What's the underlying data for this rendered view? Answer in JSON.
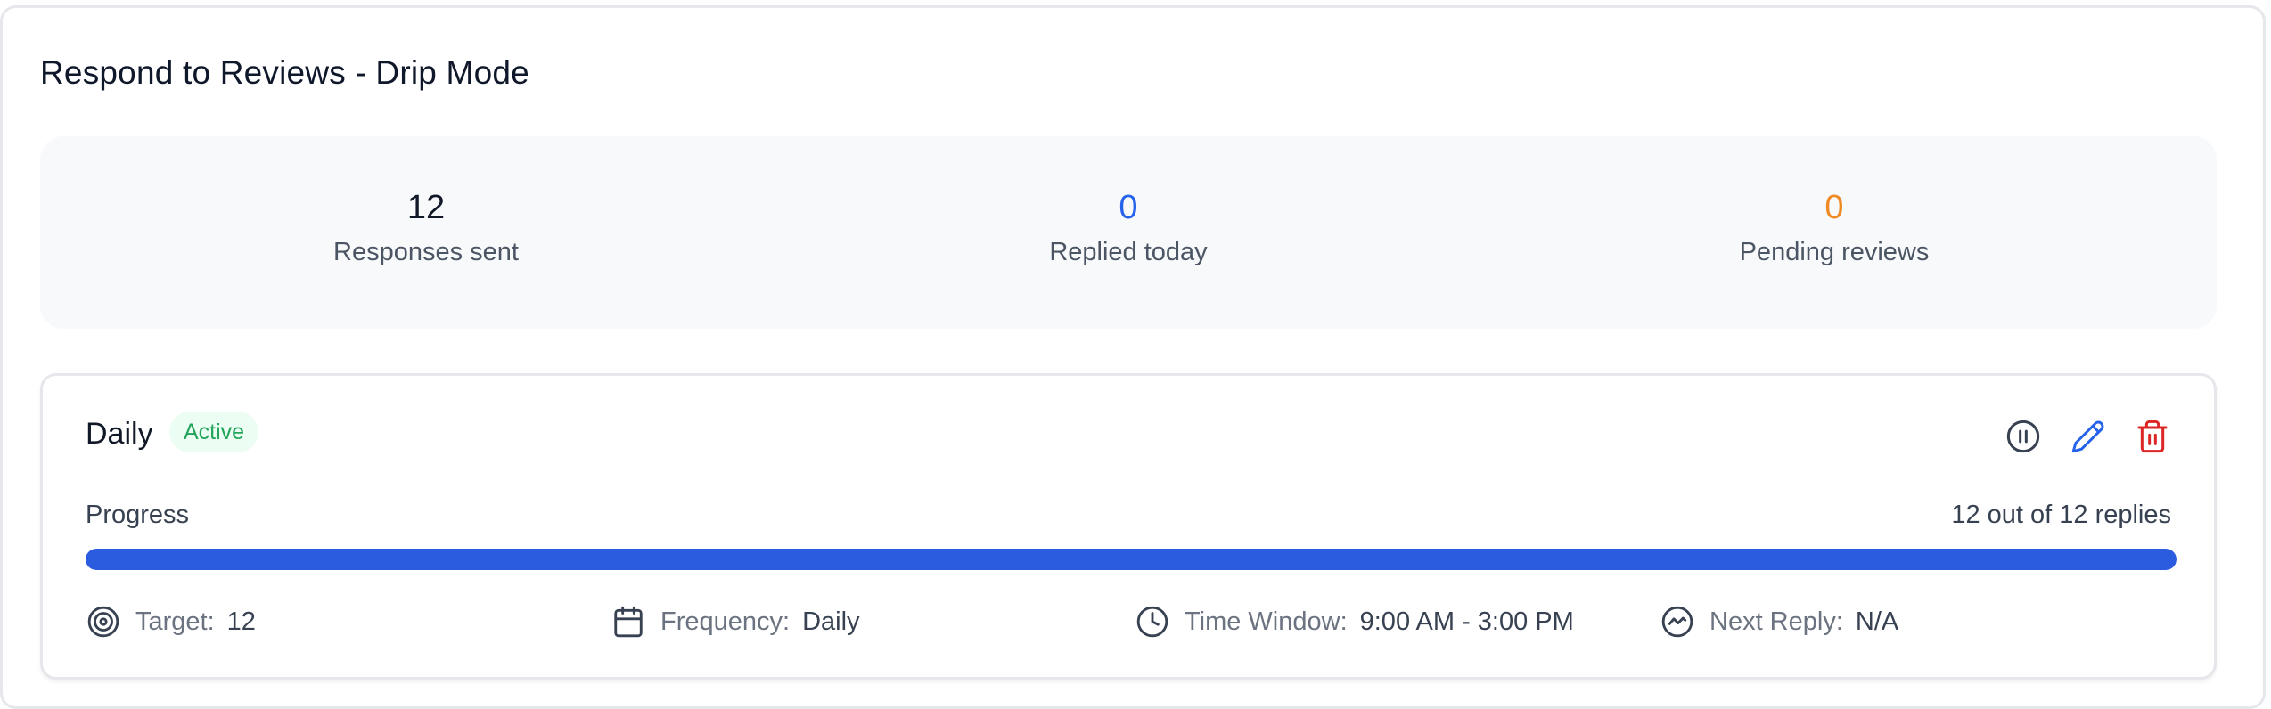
{
  "header": {
    "title": "Respond to Reviews - Drip Mode"
  },
  "stats": [
    {
      "value": "12",
      "label": "Responses sent",
      "color": "#111827"
    },
    {
      "value": "0",
      "label": "Replied today",
      "color": "#2563eb"
    },
    {
      "value": "0",
      "label": "Pending reviews",
      "color": "#f08a24"
    }
  ],
  "schedule": {
    "title": "Daily",
    "status": "Active",
    "actions": {
      "pause_icon": "pause-circle-icon",
      "edit_icon": "pencil-icon",
      "delete_icon": "trash-icon"
    },
    "progress": {
      "label": "Progress",
      "count_text": "12 out of 12 replies",
      "fraction": 1.0,
      "fill_color": "#2b5bdf"
    },
    "meta": {
      "target": {
        "label": "Target:",
        "value": "12",
        "icon": "target-icon"
      },
      "frequency": {
        "label": "Frequency:",
        "value": "Daily",
        "icon": "calendar-icon"
      },
      "time_window": {
        "label": "Time Window:",
        "value": "9:00 AM - 3:00 PM",
        "icon": "clock-icon"
      },
      "next_reply": {
        "label": "Next Reply:",
        "value": "N/A",
        "icon": "activity-icon"
      }
    }
  }
}
